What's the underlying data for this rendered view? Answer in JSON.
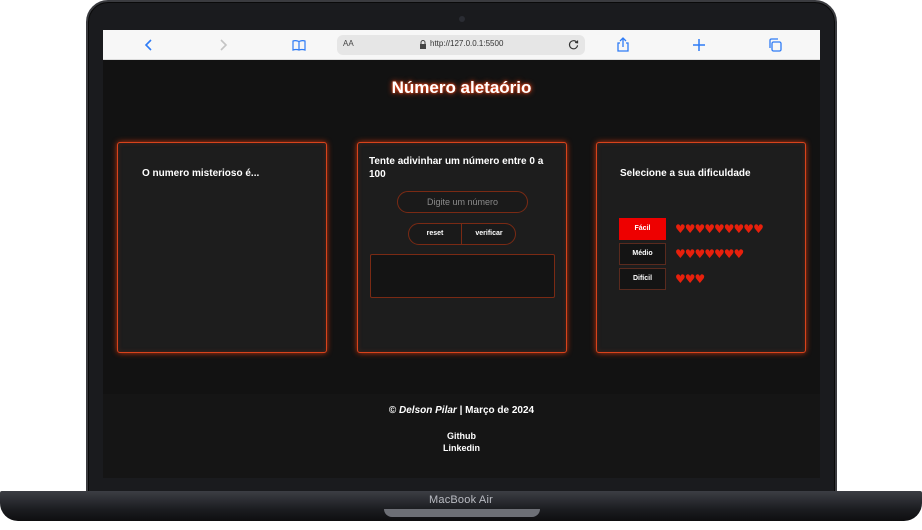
{
  "browser": {
    "aa_label": "AA",
    "url": "http://127.0.0.1:5500",
    "icons": [
      "back-icon",
      "forward-icon",
      "reader-icon",
      "lock-icon",
      "reload-icon",
      "share-icon",
      "new-tab-icon",
      "tabs-icon"
    ]
  },
  "page": {
    "title": "Número aletaório"
  },
  "cards": {
    "mystery": {
      "title": "O numero misterioso é..."
    },
    "guess": {
      "title": "Tente adivinhar um número entre 0 a 100",
      "input_placeholder": "Digite um número",
      "reset_label": "reset",
      "verify_label": "verificar"
    },
    "difficulty": {
      "title": "Selecione a sua dificuldade",
      "levels": [
        {
          "label": "Fácil",
          "hearts": "♥♥♥♥♥♥♥♥♥",
          "lives": 9,
          "selected": true
        },
        {
          "label": "Médio",
          "hearts": "♥♥♥♥♥♥♥",
          "lives": 7,
          "selected": false
        },
        {
          "label": "Difícil",
          "hearts": "♥♥♥",
          "lives": 3,
          "selected": false
        }
      ]
    }
  },
  "footer": {
    "copyright_symbol": "©",
    "author": "Delson Pilar",
    "date": "| Março de 2024",
    "links": [
      "Github",
      "Linkedin"
    ]
  },
  "device": {
    "model": "MacBook Air"
  },
  "colors": {
    "accent": "#ee0000",
    "glow": "#d8431c",
    "background": "#121212",
    "card": "#1d1d1d",
    "heart": "#e8200c"
  }
}
